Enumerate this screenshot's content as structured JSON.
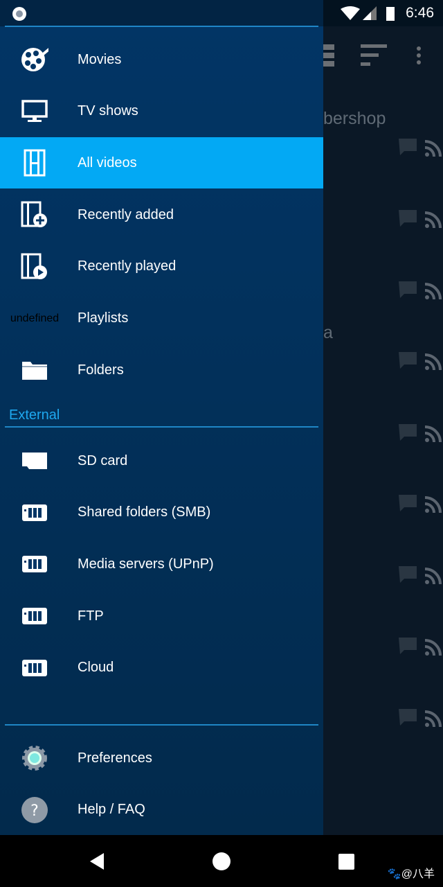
{
  "status": {
    "time": "6:46"
  },
  "background": {
    "title_fragment": "bershop",
    "fragment2": "a"
  },
  "drawer": {
    "items": [
      {
        "label": "Movies",
        "icon": "film-reel-icon"
      },
      {
        "label": "TV shows",
        "icon": "monitor-icon"
      },
      {
        "label": "All videos",
        "icon": "film-strip-icon",
        "selected": true
      },
      {
        "label": "Recently added",
        "icon": "film-add-icon"
      },
      {
        "label": "Recently played",
        "icon": "film-play-icon"
      },
      {
        "label": "Playlists",
        "icon": "playlist-icon"
      },
      {
        "label": "Folders",
        "icon": "folder-icon"
      }
    ],
    "section_external": "External",
    "external": [
      {
        "label": "SD card",
        "icon": "sd-card-icon"
      },
      {
        "label": "Shared folders (SMB)",
        "icon": "server-icon"
      },
      {
        "label": "Media servers (UPnP)",
        "icon": "server-icon"
      },
      {
        "label": "FTP",
        "icon": "server-icon"
      },
      {
        "label": "Cloud",
        "icon": "server-icon"
      }
    ],
    "bottom": [
      {
        "label": "Preferences",
        "icon": "gear-icon"
      },
      {
        "label": "Help / FAQ",
        "icon": "help-icon"
      }
    ]
  },
  "watermark": "🐾@八羊",
  "colors": {
    "accent": "#03a9f4",
    "drawer": "#023565",
    "section": "#1ea8ef"
  }
}
